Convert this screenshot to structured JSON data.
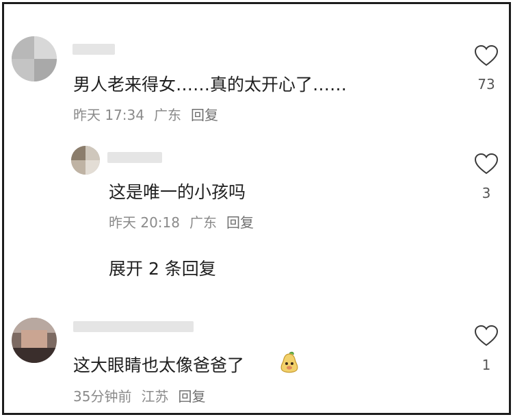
{
  "comments": [
    {
      "text": "男人老来得女……真的太开心了……",
      "time": "昨天 17:34",
      "location": "广东",
      "reply_label": "回复",
      "likes": "73",
      "icons": {
        "like": "heart-outline-icon"
      }
    },
    {
      "text": "这是唯一的小孩吗",
      "time": "昨天 20:18",
      "location": "广东",
      "reply_label": "回复",
      "likes": "3",
      "icons": {
        "like": "heart-outline-icon"
      }
    },
    {
      "text": "这大眼睛也太像爸爸了",
      "time": "35分钟前",
      "location": "江苏",
      "reply_label": "回复",
      "likes": "1",
      "icons": {
        "like": "heart-outline-icon",
        "emoji": "pear-face-emoji-icon"
      }
    }
  ],
  "expand_replies": "展开 2 条回复",
  "colors": {
    "text": "#1f1f1f",
    "meta": "#8a8a8a",
    "border": "#1c1c1c"
  }
}
